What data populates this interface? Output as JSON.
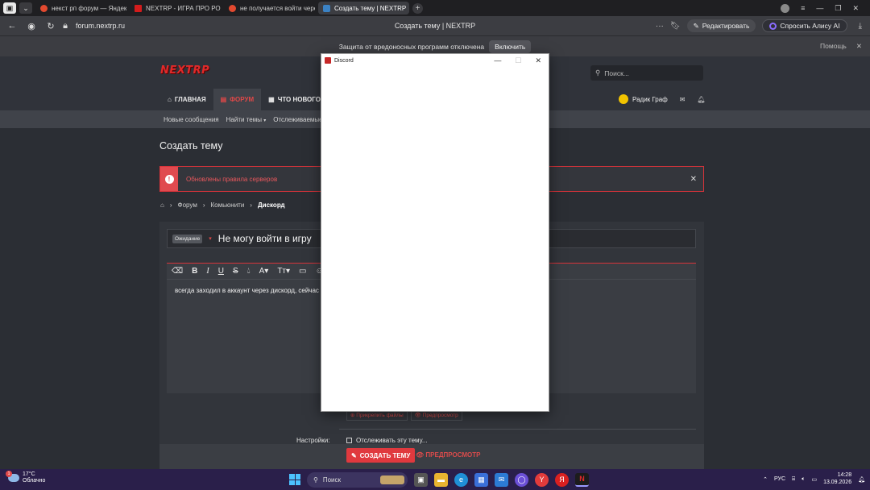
{
  "browser": {
    "tabs": [
      {
        "label": "некст рп форум — Яндекс",
        "color": "#e2492f"
      },
      {
        "label": "NEXTRP - ИГРА ПРО РОССИЮ",
        "color": "#d31c1c"
      },
      {
        "label": "не получается войти через",
        "color": "#e2492f"
      },
      {
        "label": "Создать тему | NEXTRP",
        "color": "#3b82c4"
      }
    ],
    "address": "forum.nextrp.ru",
    "page_title": "Создать тему | NEXTRP",
    "edit_label": "Редактировать",
    "alice_label": "Спросить Алису AI",
    "infobar_text": "Защита от вредоносных программ отключена",
    "infobar_button": "Включить",
    "help_label": "Помощь"
  },
  "site": {
    "logo": "NEXTRP",
    "search_placeholder": "Поиск...",
    "nav": [
      "ГЛАВНАЯ",
      "ФОРУМ",
      "ЧТО НОВОГО"
    ],
    "user_name": "Радик Граф",
    "subnav": [
      "Новые сообщения",
      "Найти темы",
      "Отслеживаемые"
    ],
    "page_heading": "Создать тему",
    "notice": "Обновлены правила серверов",
    "breadcrumbs": [
      "Форум",
      "Комьюнити",
      "Дискорд"
    ],
    "prefix": "Ожидание",
    "thread_title": "Не могу войти в игру",
    "editor_text": "всегда заходил в аккаунт через дискорд, сейчас",
    "attach_label": "Прикрепить файлы",
    "preview_small": "Предпросмотр",
    "settings_label": "Настройки:",
    "watch_label": "Отслеживать эту тему...",
    "submit_label": "СОЗДАТЬ ТЕМУ",
    "preview_label": "ПРЕДПРОСМОТР"
  },
  "discord_window": {
    "title": "Discord"
  },
  "taskbar": {
    "temperature": "17°C",
    "weather": "Облачно",
    "weather_badge": "1",
    "search": "Поиск",
    "lang": "РУС",
    "time": "14:28",
    "date": "13.09.2026"
  },
  "colors": {
    "accent": "#e0393e",
    "taskbar": "#2a1f4a"
  }
}
